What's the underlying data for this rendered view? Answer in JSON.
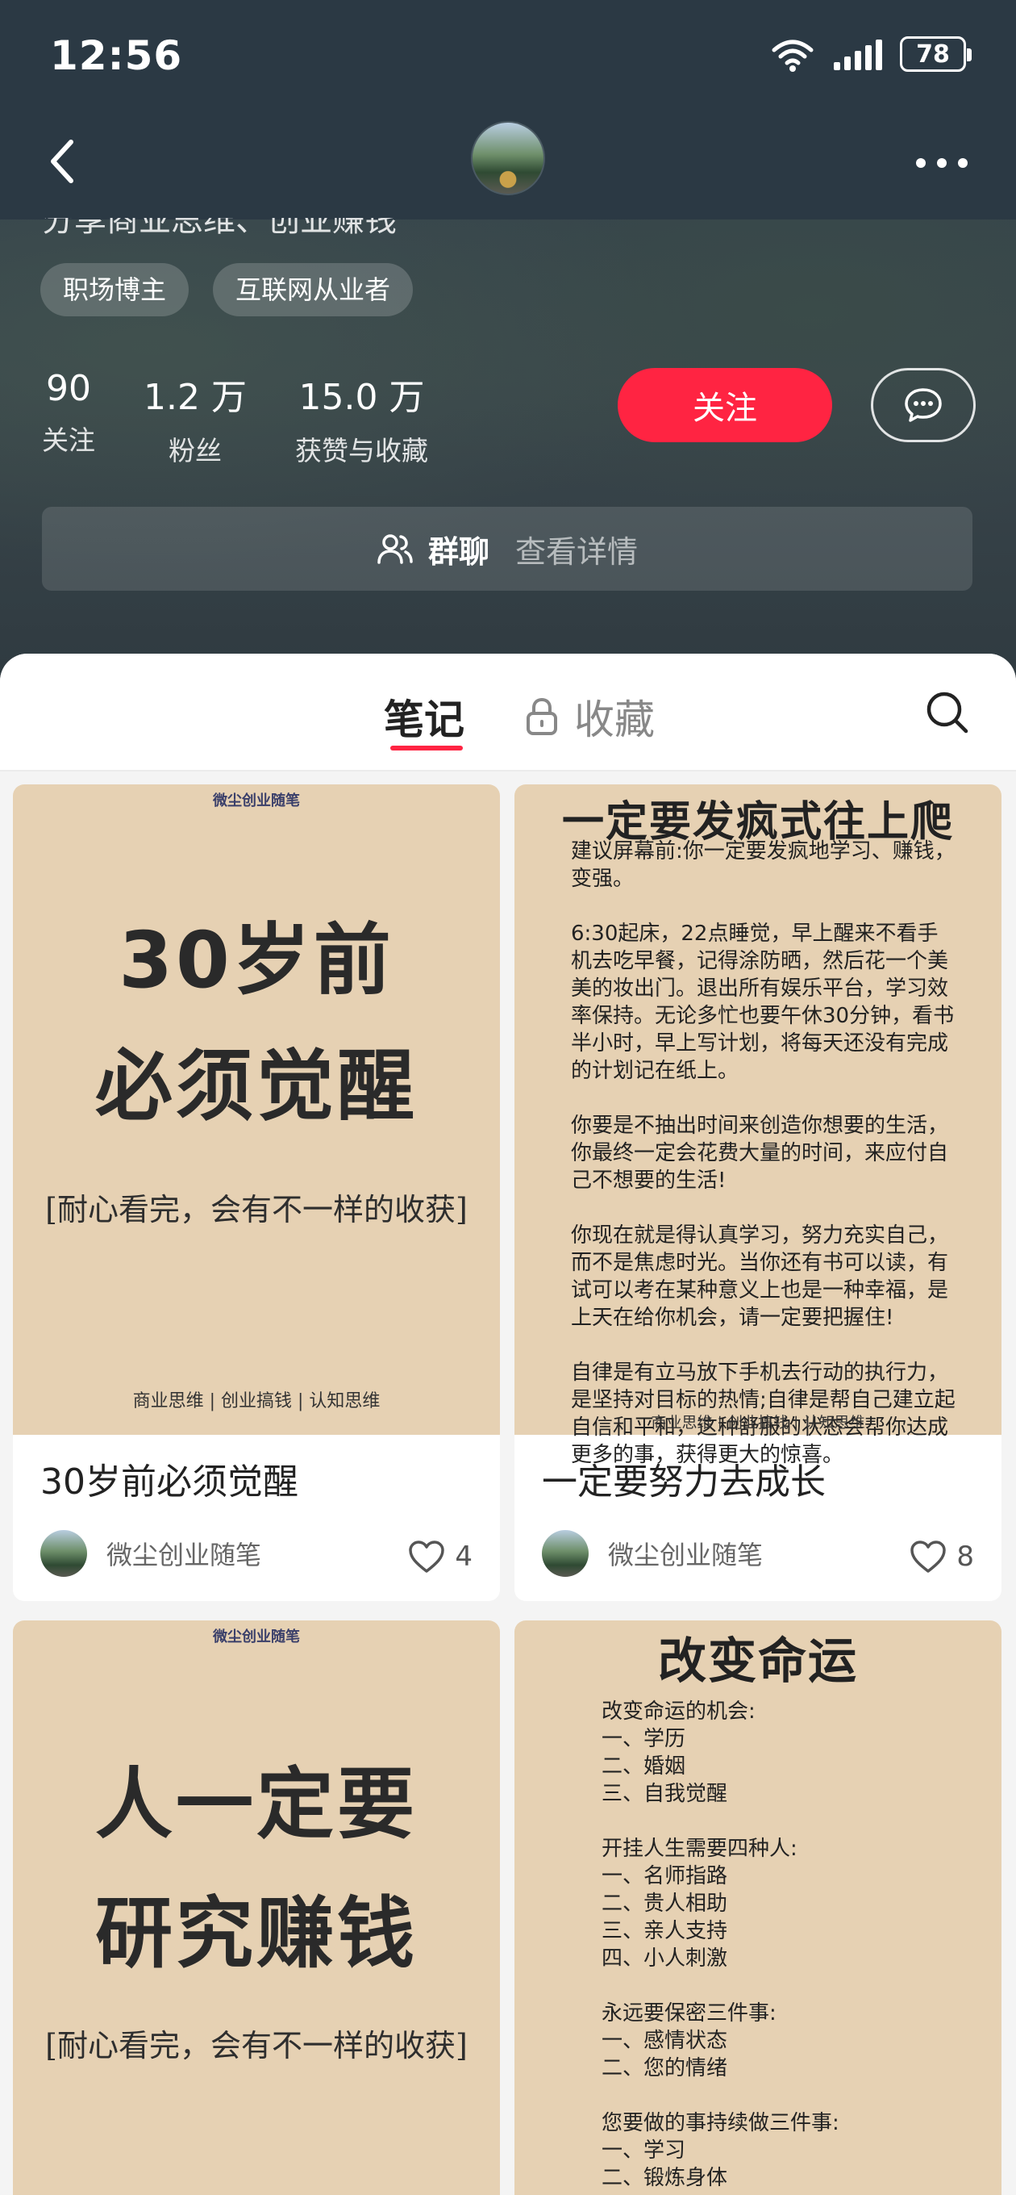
{
  "status_bar": {
    "time": "12:56",
    "battery": "78"
  },
  "profile": {
    "bio_partial": "分享商业思维、创业赚钱",
    "tags": [
      "职场博主",
      "互联网从业者"
    ],
    "stats": [
      {
        "value": "90",
        "label": "关注"
      },
      {
        "value": "1.2 万",
        "label": "粉丝"
      },
      {
        "value": "15.0 万",
        "label": "获赞与收藏"
      }
    ],
    "follow_label": "关注",
    "group_title": "群聊",
    "group_detail": "查看详情"
  },
  "tabs": {
    "notes": "笔记",
    "collections": "收藏"
  },
  "notes": [
    {
      "cover_watermark": "微尘创业随笔",
      "cover_line1": "30岁前",
      "cover_line2": "必须觉醒",
      "cover_sub": "[耐心看完，会有不一样的收获]",
      "cover_foot": "商业思维 | 创业搞钱 | 认知思维",
      "title": "30岁前必须觉醒",
      "author": "微尘创业随笔",
      "likes": "4"
    },
    {
      "cover_head": "一定要发疯式往上爬",
      "cover_body": "建议屏幕前:你一定要发疯地学习、赚钱，变强。\n\n6:30起床，22点睡觉，早上醒来不看手机去吃早餐，记得涂防晒，然后花一个美美的妆出门。退出所有娱乐平台，学习效率保持。无论多忙也要午休30分钟，看书半小时，早上写计划，将每天还没有完成的计划记在纸上。\n\n你要是不抽出时间来创造你想要的生活，你最终一定会花费大量的时间，来应付自己不想要的生活!\n\n你现在就是得认真学习，努力充实自己，而不是焦虑时光。当你还有书可以读，有试可以考在某种意义上也是一种幸福，是上天在给你机会，请一定要把握住!\n\n自律是有立马放下手机去行动的执行力，是坚持对目标的热情;自律是帮自己建立起自信和平和，这种舒服的状态会帮你达成更多的事，获得更大的惊喜。",
      "cover_foot": "商业思维 | 创业搞钱 | 认知思维",
      "title": "一定要努力去成长",
      "author": "微尘创业随笔",
      "likes": "8"
    },
    {
      "cover_watermark": "微尘创业随笔",
      "cover_line1": "人一定要",
      "cover_line2": "研究赚钱",
      "cover_sub": "[耐心看完，会有不一样的收获]"
    },
    {
      "cover_head": "改变命运",
      "cover_body": "改变命运的机会:\n一、学历\n二、婚姻\n三、自我觉醒\n\n开挂人生需要四种人:\n一、名师指路\n二、贵人相助\n三、亲人支持\n四、小人刺激\n\n永远要保密三件事:\n一、感情状态\n二、您的情绪\n\n您要做的事持续做三件事:\n一、学习\n二、锻炼身体"
    }
  ],
  "colors": {
    "accent": "#ff2442",
    "cover_bg": "#e6d1b3",
    "header_bg": "#2b3944"
  }
}
